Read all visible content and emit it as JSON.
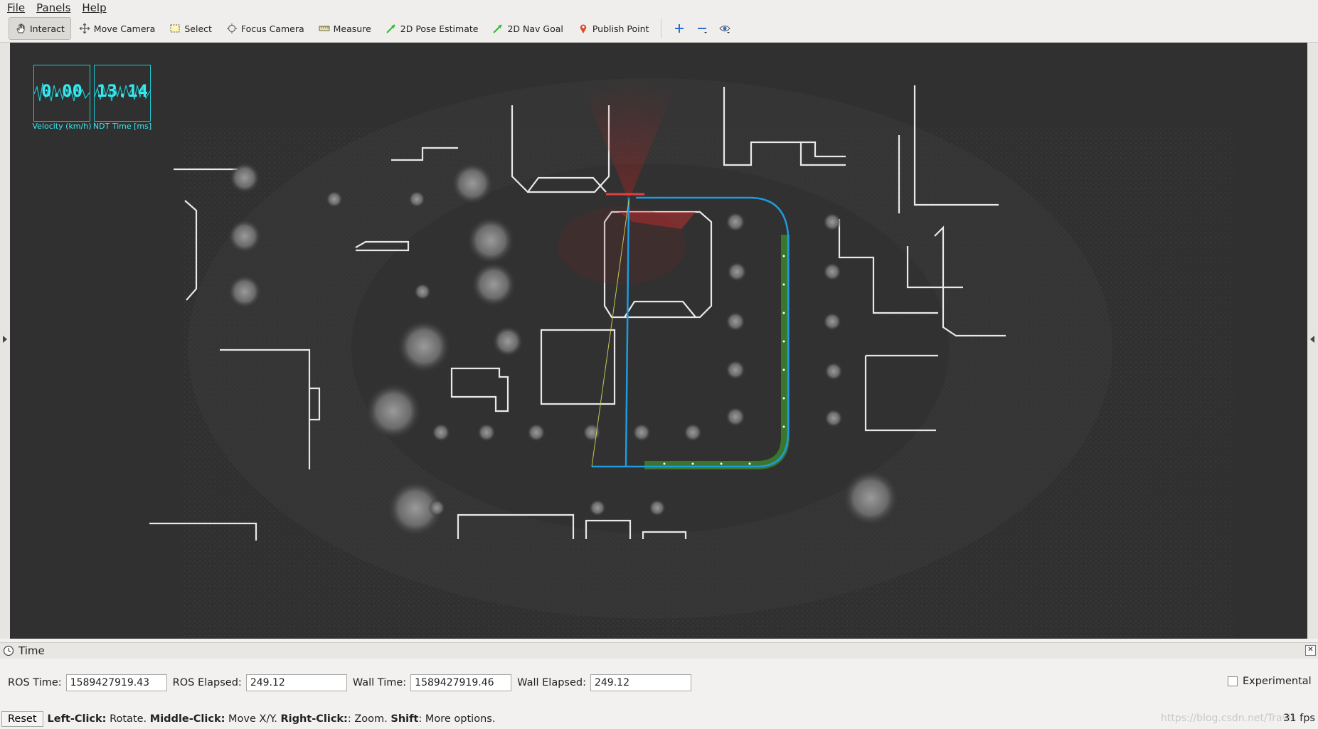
{
  "menu": {
    "file": "File",
    "panels": "Panels",
    "help": "Help"
  },
  "toolbar": {
    "interact": "Interact",
    "move_camera": "Move Camera",
    "select": "Select",
    "focus_camera": "Focus Camera",
    "measure": "Measure",
    "pose_estimate": "2D Pose Estimate",
    "nav_goal": "2D Nav Goal",
    "publish_point": "Publish Point"
  },
  "overlays": {
    "velocity": {
      "value": "0.00",
      "caption": "Velocity (km/h)"
    },
    "ndt_time": {
      "value": "13.14",
      "caption": "NDT Time [ms]"
    }
  },
  "time_panel": {
    "title": "Time",
    "ros_time_label": "ROS Time:",
    "ros_time": "1589427919.43",
    "ros_elapsed_label": "ROS Elapsed:",
    "ros_elapsed": "249.12",
    "wall_time_label": "Wall Time:",
    "wall_time": "1589427919.46",
    "wall_elapsed_label": "Wall Elapsed:",
    "wall_elapsed": "249.12",
    "experimental": "Experimental"
  },
  "status": {
    "reset": "Reset",
    "left_click": "Left-Click:",
    "left_click_desc": " Rotate. ",
    "middle_click": "Middle-Click:",
    "middle_click_desc": " Move X/Y. ",
    "right_click": "Right-Click:",
    "right_click_desc": ": Zoom. ",
    "shift": "Shift",
    "shift_desc": ": More options.",
    "fps": "31 fps",
    "watermark": "https://blog.csdn.net/Travis"
  },
  "colors": {
    "path_blue": "#1e9be0",
    "trail_green": "#3e8e2a",
    "overlay_cyan": "#38e8f0",
    "scan_red": "#d02020"
  }
}
